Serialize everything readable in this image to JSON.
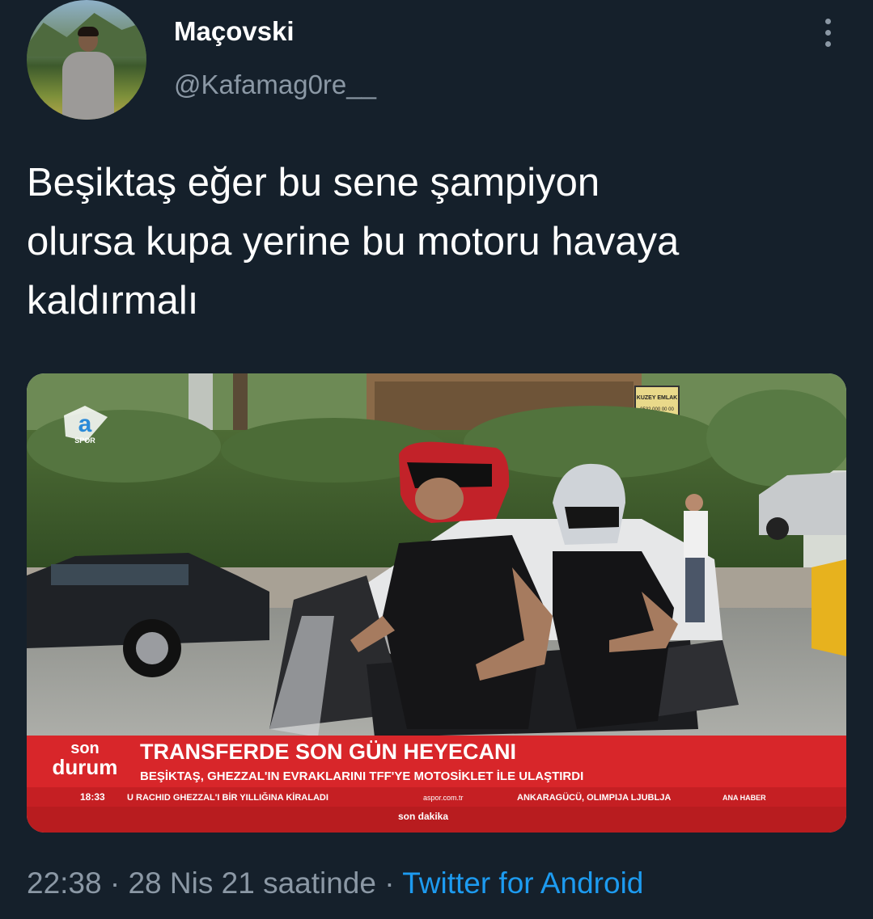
{
  "user": {
    "display_name": "Maçovski",
    "handle": "@Kafamag0re__"
  },
  "tweet": {
    "text": "Beşiktaş eğer bu sene şampiyon\nolursa kupa yerine bu motoru havaya\nkaldırmalı"
  },
  "media": {
    "channel_logo": "a",
    "channel_sub": "SPOR",
    "shop_sign_line1": "KUZEY EMLAK",
    "shop_sign_line2": "0532 000 00 00",
    "ticker_brand_top": "son",
    "ticker_brand_bottom": "durum",
    "headline": "TRANSFERDE SON GÜN HEYECANI",
    "subheadline": "BEŞİKTAŞ, GHEZZAL'IN EVRAKLARINI TFF'YE MOTOSİKLET İLE ULAŞTIRDI",
    "ticker_time": "18:33",
    "ticker_text_1": "U RACHID GHEZZAL'I BİR YILLIĞINA KİRALADI",
    "ticker_site": "aspor.com.tr",
    "ticker_text_2": "ANKARAGÜCÜ, OLIMPIJA LJUBLJA",
    "ticker_text_3": "ANA HABER",
    "breaking_label": "son dakika"
  },
  "meta": {
    "time": "22:38",
    "separator_1": " · ",
    "date": "28 Nis 21 saatinde",
    "separator_2": " · ",
    "app": "Twitter for Android"
  },
  "colors": {
    "background": "#15202b",
    "secondary_text": "#8b98a5",
    "link": "#1d9bf0",
    "ticker_red": "#d8262a"
  },
  "icons": {
    "more": "more-vertical-icon"
  }
}
